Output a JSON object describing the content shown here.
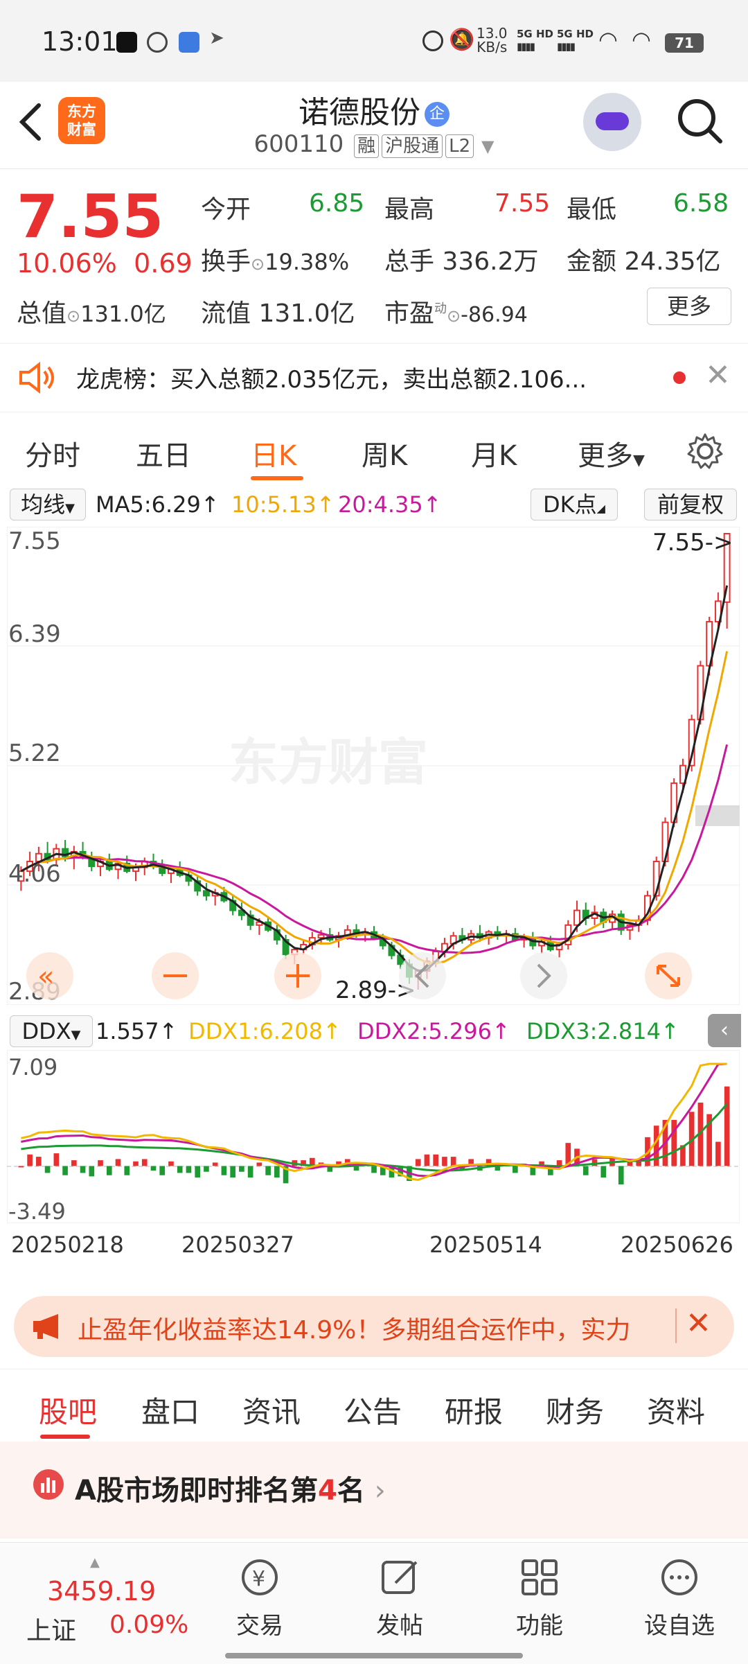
{
  "status_bar": {
    "time": "13:01",
    "net_speed_value": "13.0",
    "net_speed_unit": "KB/s",
    "sig1": "5G HD",
    "sig2": "5G HD",
    "battery": "71"
  },
  "header": {
    "stock_name": "诺德股份",
    "qi_badge": "企",
    "code": "600110",
    "tags": [
      "融",
      "沪股通",
      "L2"
    ],
    "logo_line1": "东方",
    "logo_line2": "财富"
  },
  "quote": {
    "price": "7.55",
    "change_pct": "10.06%",
    "change": "0.69",
    "open_label": "今开",
    "open": "6.85",
    "high_label": "最高",
    "high": "7.55",
    "low_label": "最低",
    "low": "6.58",
    "turnover_label": "换手",
    "turnover": "19.38%",
    "volume_label": "总手",
    "volume": "336.2万",
    "amount_label": "金额",
    "amount": "24.35亿",
    "mktcap_label": "总值",
    "mktcap": "131.0亿",
    "float_label": "流值",
    "float": "131.0亿",
    "pe_label": "市盈",
    "pe_sup": "动",
    "pe": "-86.94",
    "more_label": "更多"
  },
  "notice": {
    "text": "龙虎榜：买入总额2.035亿元，卖出总额2.106..."
  },
  "chart_tabs": [
    "分时",
    "五日",
    "日K",
    "周K",
    "月K",
    "更多"
  ],
  "chart_tabs_active": "日K",
  "ma_row": {
    "selector": "均线",
    "ma5": "MA5:6.29",
    "ma10": "10:5.13",
    "ma20": "20:4.35",
    "arrow": "↑",
    "dk": "DK点",
    "fq": "前复权"
  },
  "k_axis": {
    "y1": "7.55",
    "y2": "6.39",
    "y3": "5.22",
    "y4": "4.06",
    "y5": "2.89",
    "max_label": "7.55->",
    "min_label": "2.89->",
    "watermark": "东方财富"
  },
  "ddx_row": {
    "selector": "DDX",
    "ddx": "1.557",
    "ddx1": "DDX1:6.208",
    "ddx2": "DDX2:5.296",
    "ddx3": "DDX3:2.814",
    "arrow": "↑",
    "y_top": "7.09",
    "y_bottom": "-3.49"
  },
  "dates": [
    "20250218",
    "20250327",
    "20250514",
    "20250626"
  ],
  "ad": {
    "text": "止盈年化收益率达14.9%！多期组合运作中，实力"
  },
  "bottom_tabs": [
    "股吧",
    "盘口",
    "资讯",
    "公告",
    "研报",
    "财务",
    "资料"
  ],
  "bottom_tabs_active": "股吧",
  "rank": {
    "text_a": "A股市场即时排名第",
    "rank_num": "4",
    "text_b": "名"
  },
  "index": {
    "value": "3459.19",
    "name": "上证",
    "pct": "0.09%"
  },
  "nav": [
    "交易",
    "发帖",
    "功能",
    "设自选"
  ],
  "colors": {
    "up": "#e93030",
    "down": "#1d9a31",
    "accent": "#ff6a1a",
    "ma5": "#222222",
    "ma10": "#f0a800",
    "ma20": "#c8189c"
  },
  "chart_data": {
    "type": "candlestick",
    "price_axis": {
      "max": 7.55,
      "min": 2.89,
      "ticks": [
        7.55,
        6.39,
        5.22,
        4.06,
        2.89
      ]
    },
    "candles": [
      [
        4.0,
        4.15,
        3.9,
        4.1
      ],
      [
        4.1,
        4.3,
        4.05,
        4.2
      ],
      [
        4.2,
        4.35,
        4.1,
        4.28
      ],
      [
        4.28,
        4.4,
        4.18,
        4.22
      ],
      [
        4.22,
        4.38,
        4.15,
        4.33
      ],
      [
        4.33,
        4.42,
        4.2,
        4.25
      ],
      [
        4.25,
        4.36,
        4.12,
        4.3
      ],
      [
        4.3,
        4.4,
        4.22,
        4.24
      ],
      [
        4.24,
        4.3,
        4.1,
        4.15
      ],
      [
        4.15,
        4.25,
        4.05,
        4.2
      ],
      [
        4.2,
        4.28,
        4.1,
        4.12
      ],
      [
        4.12,
        4.2,
        4.02,
        4.18
      ],
      [
        4.18,
        4.26,
        4.08,
        4.1
      ],
      [
        4.1,
        4.18,
        4.0,
        4.14
      ],
      [
        4.14,
        4.24,
        4.06,
        4.2
      ],
      [
        4.2,
        4.28,
        4.12,
        4.16
      ],
      [
        4.16,
        4.22,
        4.05,
        4.08
      ],
      [
        4.08,
        4.15,
        3.98,
        4.12
      ],
      [
        4.12,
        4.2,
        4.04,
        4.06
      ],
      [
        4.06,
        4.12,
        3.95,
        4.0
      ],
      [
        4.0,
        4.05,
        3.85,
        3.9
      ],
      [
        3.9,
        3.98,
        3.8,
        3.85
      ],
      [
        3.85,
        3.92,
        3.75,
        3.88
      ],
      [
        3.88,
        3.94,
        3.78,
        3.8
      ],
      [
        3.8,
        3.85,
        3.65,
        3.7
      ],
      [
        3.7,
        3.78,
        3.6,
        3.65
      ],
      [
        3.65,
        3.7,
        3.5,
        3.55
      ],
      [
        3.55,
        3.62,
        3.45,
        3.58
      ],
      [
        3.58,
        3.64,
        3.48,
        3.5
      ],
      [
        3.5,
        3.55,
        3.35,
        3.4
      ],
      [
        3.4,
        3.45,
        3.2,
        3.25
      ],
      [
        3.25,
        3.32,
        3.15,
        3.3
      ],
      [
        3.3,
        3.4,
        3.25,
        3.35
      ],
      [
        3.35,
        3.48,
        3.3,
        3.42
      ],
      [
        3.42,
        3.5,
        3.35,
        3.45
      ],
      [
        3.45,
        3.52,
        3.38,
        3.4
      ],
      [
        3.4,
        3.48,
        3.32,
        3.44
      ],
      [
        3.44,
        3.55,
        3.4,
        3.5
      ],
      [
        3.5,
        3.56,
        3.42,
        3.46
      ],
      [
        3.46,
        3.52,
        3.38,
        3.48
      ],
      [
        3.48,
        3.54,
        3.4,
        3.42
      ],
      [
        3.42,
        3.46,
        3.3,
        3.34
      ],
      [
        3.34,
        3.38,
        3.2,
        3.24
      ],
      [
        3.24,
        3.3,
        3.1,
        3.15
      ],
      [
        3.15,
        3.2,
        2.95,
        3.02
      ],
      [
        3.02,
        3.1,
        2.89,
        3.08
      ],
      [
        3.08,
        3.22,
        3.0,
        3.18
      ],
      [
        3.18,
        3.32,
        3.12,
        3.28
      ],
      [
        3.28,
        3.42,
        3.22,
        3.36
      ],
      [
        3.36,
        3.48,
        3.3,
        3.44
      ],
      [
        3.44,
        3.52,
        3.36,
        3.4
      ],
      [
        3.4,
        3.5,
        3.34,
        3.46
      ],
      [
        3.46,
        3.55,
        3.38,
        3.42
      ],
      [
        3.42,
        3.5,
        3.35,
        3.48
      ],
      [
        3.48,
        3.54,
        3.4,
        3.44
      ],
      [
        3.44,
        3.5,
        3.36,
        3.46
      ],
      [
        3.46,
        3.52,
        3.38,
        3.4
      ],
      [
        3.4,
        3.46,
        3.32,
        3.42
      ],
      [
        3.42,
        3.48,
        3.3,
        3.34
      ],
      [
        3.34,
        3.4,
        3.26,
        3.38
      ],
      [
        3.38,
        3.44,
        3.28,
        3.3
      ],
      [
        3.3,
        3.38,
        3.22,
        3.35
      ],
      [
        3.35,
        3.6,
        3.3,
        3.55
      ],
      [
        3.55,
        3.8,
        3.48,
        3.7
      ],
      [
        3.7,
        3.78,
        3.55,
        3.62
      ],
      [
        3.62,
        3.75,
        3.55,
        3.68
      ],
      [
        3.68,
        3.72,
        3.52,
        3.58
      ],
      [
        3.58,
        3.7,
        3.5,
        3.66
      ],
      [
        3.66,
        3.7,
        3.45,
        3.5
      ],
      [
        3.5,
        3.58,
        3.4,
        3.55
      ],
      [
        3.55,
        3.65,
        3.48,
        3.6
      ],
      [
        3.6,
        3.9,
        3.55,
        3.85
      ],
      [
        3.85,
        4.25,
        3.8,
        4.2
      ],
      [
        4.2,
        4.65,
        4.15,
        4.6
      ],
      [
        4.6,
        5.05,
        4.55,
        5.0
      ],
      [
        5.0,
        5.25,
        4.9,
        5.18
      ],
      [
        5.18,
        5.7,
        5.12,
        5.65
      ],
      [
        5.65,
        6.25,
        5.6,
        6.2
      ],
      [
        6.2,
        6.7,
        6.1,
        6.65
      ],
      [
        6.65,
        6.95,
        6.58,
        6.86
      ],
      [
        6.85,
        7.55,
        6.58,
        7.55
      ]
    ],
    "ddx_axis": {
      "max": 7.09,
      "min": -3.49
    }
  }
}
